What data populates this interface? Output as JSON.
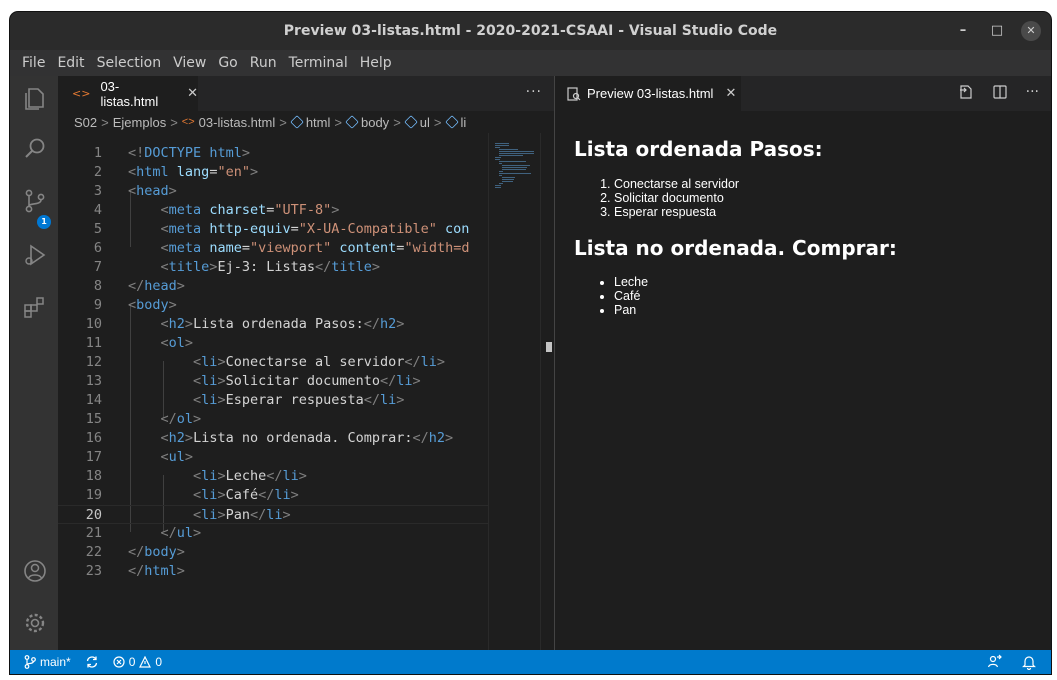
{
  "window": {
    "title": "Preview 03-listas.html - 2020-2021-CSAAI - Visual Studio Code",
    "controls": {
      "minimize": "–",
      "maximize": "□",
      "close": "✕"
    }
  },
  "menubar": [
    "File",
    "Edit",
    "Selection",
    "View",
    "Go",
    "Run",
    "Terminal",
    "Help"
  ],
  "activitybar": {
    "items": [
      "explorer-icon",
      "search-icon",
      "source-control-icon",
      "run-debug-icon",
      "extensions-icon",
      "accounts-icon",
      "settings-gear-icon"
    ],
    "source_control_badge": "1"
  },
  "editor": {
    "tab": {
      "label": "03-listas.html",
      "icon": "html-file-icon",
      "close": "✕"
    },
    "more_actions": "···",
    "breadcrumbs": [
      "S02",
      "Ejemplos",
      "03-listas.html",
      "html",
      "body",
      "ul",
      "li"
    ],
    "current_line": 20,
    "lines": [
      {
        "n": "1",
        "text": "<!DOCTYPE html>"
      },
      {
        "n": "2",
        "text": "<html lang=\"en\">"
      },
      {
        "n": "3",
        "text": "<head>"
      },
      {
        "n": "4",
        "text": "    <meta charset=\"UTF-8\">"
      },
      {
        "n": "5",
        "text": "    <meta http-equiv=\"X-UA-Compatible\" cont"
      },
      {
        "n": "6",
        "text": "    <meta name=\"viewport\" content=\"width=de"
      },
      {
        "n": "7",
        "text": "    <title>Ej-3: Listas</title>"
      },
      {
        "n": "8",
        "text": "</head>"
      },
      {
        "n": "9",
        "text": "<body>"
      },
      {
        "n": "10",
        "text": "    <h2>Lista ordenada Pasos:</h2>"
      },
      {
        "n": "11",
        "text": "    <ol>"
      },
      {
        "n": "12",
        "text": "        <li>Conectarse al servidor</li>"
      },
      {
        "n": "13",
        "text": "        <li>Solicitar documento</li>"
      },
      {
        "n": "14",
        "text": "        <li>Esperar respuesta</li>"
      },
      {
        "n": "15",
        "text": "    </ol>"
      },
      {
        "n": "16",
        "text": "    <h2>Lista no ordenada. Comprar:</h2>"
      },
      {
        "n": "17",
        "text": "    <ul>"
      },
      {
        "n": "18",
        "text": "        <li>Leche</li>"
      },
      {
        "n": "19",
        "text": "        <li>Café</li>"
      },
      {
        "n": "20",
        "text": "        <li>Pan</li>"
      },
      {
        "n": "21",
        "text": "    </ul>"
      },
      {
        "n": "22",
        "text": "</body>"
      },
      {
        "n": "23",
        "text": "</html>"
      }
    ]
  },
  "preview": {
    "tab": {
      "label": "Preview 03-listas.html",
      "icon": "preview-icon",
      "close": "✕"
    },
    "actions": [
      "open-source-icon",
      "split-editor-icon",
      "more-actions-icon"
    ],
    "more_actions": "···",
    "heading1": "Lista ordenada Pasos:",
    "ordered_list": [
      "Conectarse al servidor",
      "Solicitar documento",
      "Esperar respuesta"
    ],
    "heading2": "Lista no ordenada. Comprar:",
    "unordered_list": [
      "Leche",
      "Café",
      "Pan"
    ]
  },
  "statusbar": {
    "branch": "main*",
    "errors": "0",
    "warnings": "0",
    "right_icons": [
      "live-share-icon",
      "notifications-bell-icon"
    ]
  },
  "colors": {
    "statusbar": "#007acc",
    "tag": "#569cd6",
    "attribute": "#9cdcfe",
    "string": "#ce9178",
    "text": "#d4d4d4"
  }
}
